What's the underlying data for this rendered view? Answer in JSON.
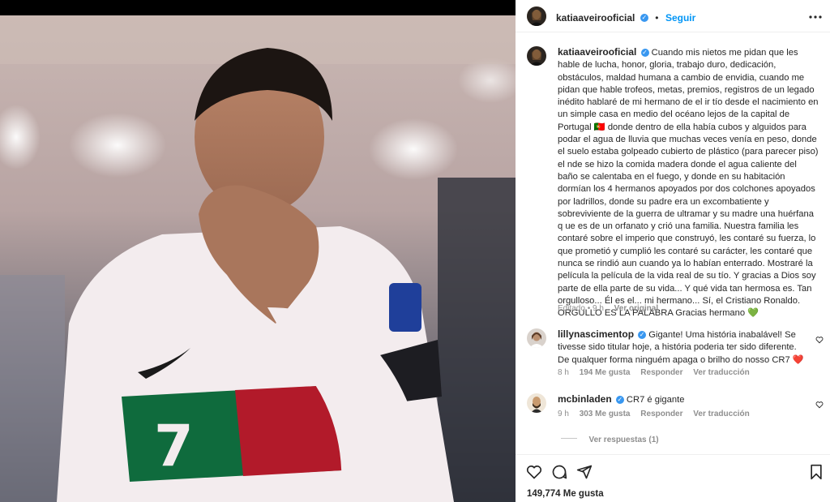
{
  "post_header": {
    "username": "katiaaveirooficial",
    "follow_label": "Seguir",
    "dot": "•",
    "more_icon": "more-horizontal-icon"
  },
  "caption": {
    "username": "katiaaveirooficial",
    "text": "Cuando mis nietos me pidan que les hable de lucha, honor, gloria, trabajo duro, dedicación, obstáculos, maldad humana a cambio de envidia, cuando me pidan que hable trofeos, metas, premios, registros de un legado inédito hablaré de mi hermano de el ir tío desde el nacimiento en un simple casa en medio del océano lejos de la capital de Portugal 🇵🇹 donde dentro de ella había cubos y alguidos para podar el agua de lluvia que muchas veces venía en peso, donde el suelo estaba golpeado cubierto de plástico (para parecer piso) el nde se hizo la comida madera donde el agua caliente del baño se calentaba en el fuego, y donde en su habitación dormían los 4 hermanos apoyados por dos colchones apoyados por ladrillos, donde su padre era un excombatiente y sobreviviente de la guerra de ultramar y su madre una huérfana q ue es de un orfanato y crió una familia. Nuestra familia les contaré sobre el imperio que construyó, les contaré su fuerza, lo que prometió y cumplió les contaré su carácter, les contaré que nunca se rindió aun cuando ya lo habían enterrado. Mostraré la película la película de la vida real de su tío. Y gracias a Dios soy parte de ella parte de su vida... Y qué vida tan hermosa es. Tan orgulloso... Él es el... mi hermano... Sí, el Cristiano Ronaldo. ORGULLO ES LA PALABRA Gracias hermano",
    "heart_emoji": "💚",
    "edited": "Editado",
    "time": "9 h",
    "translate": "Ver original"
  },
  "comments": [
    {
      "username": "lillynascimentop",
      "text": "Gigante! Uma história inabalável! Se tivesse sido titular hoje, a história poderia ter sido diferente. De qualquer forma ninguém apaga o brilho do nosso CR7",
      "emoji": "❤️",
      "time": "8 h",
      "likes": "194 Me gusta",
      "reply": "Responder",
      "translate": "Ver traducción"
    },
    {
      "username": "mcbinladen",
      "text": "CR7 é gigante",
      "time": "9 h",
      "likes": "303 Me gusta",
      "reply": "Responder",
      "translate": "Ver traducción",
      "view_replies": "Ver respuestas (1)"
    }
  ],
  "likes_count": "149,774 Me gusta",
  "colors": {
    "accent": "#0095f6",
    "verified": "#3897f0",
    "muted": "#8e8e8e",
    "heart_red": "#ed4956",
    "green_heart": "#2ecc71"
  }
}
